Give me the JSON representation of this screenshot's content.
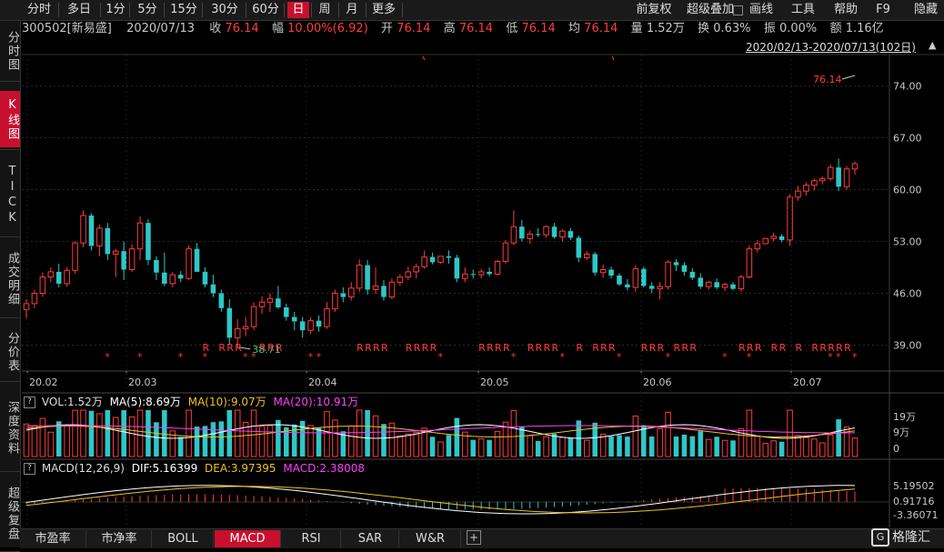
{
  "toolbar": {
    "periods": [
      "分时",
      "多日",
      "1分",
      "5分",
      "15分",
      "30分",
      "60分",
      "日",
      "周",
      "月",
      "更多"
    ],
    "active_period": "日",
    "right": [
      "前复权",
      "超级叠加",
      "画线",
      "工具",
      "帮助",
      "F9",
      "隐藏"
    ]
  },
  "sidebar": {
    "items": [
      "分时图",
      "K线图",
      "TICK",
      "成交明细",
      "分价表",
      "深度资料",
      "超级复盘"
    ],
    "active": "K线图"
  },
  "info": {
    "code": "300502[新易盛]",
    "date": "2020/07/13",
    "close_label": "收",
    "close": "76.14",
    "change_label": "幅",
    "change": "10.00%(6.92)",
    "open_label": "开",
    "open": "76.14",
    "high_label": "高",
    "high": "76.14",
    "low_label": "低",
    "low": "76.14",
    "avg_label": "均",
    "avg": "76.14",
    "volume_label": "量",
    "volume": "1.52万",
    "turnover_label": "换",
    "turnover": "0.63%",
    "amplitude_label": "振",
    "amplitude": "0.00%",
    "amount_label": "额",
    "amount": "1.16亿",
    "range": "2020/02/13-2020/07/13(102日)"
  },
  "volume_panel": {
    "label": "VOL:1.52万",
    "ma5": "MA(5):8.69万",
    "ma10": "MA(10):9.07万",
    "ma20": "MA(20):10.91万",
    "axis": [
      "19万",
      "9万",
      "0"
    ]
  },
  "macd_panel": {
    "label": "MACD(12,26,9)",
    "dif": "DIF:5.16399",
    "dea": "DEA:3.97395",
    "macd": "MACD:2.38008",
    "axis": [
      "5.19502",
      "0.91716",
      "-3.36071"
    ]
  },
  "bottom_tabs": [
    "市盈率",
    "市净率",
    "BOLL",
    "MACD",
    "RSI",
    "SAR",
    "W&R"
  ],
  "bottom_active": "MACD",
  "logo_text": "格隆汇",
  "colors": {
    "up": "#ff3b3b",
    "down": "#2fc7c7",
    "bg": "#000000",
    "accent": "#c8102e",
    "ma5": "#ffffff",
    "ma10": "#f0c020",
    "ma20": "#ff40ff"
  },
  "chart_data": {
    "type": "candlestick",
    "price_axis": [
      "74.00",
      "67.00",
      "60.00",
      "53.00",
      "46.00",
      "39.00"
    ],
    "ylim": [
      35.5,
      78
    ],
    "date_axis": [
      "20.02",
      "20.03",
      "20.04",
      "20.05",
      "20.06",
      "20.07"
    ],
    "max_label": "76.14",
    "min_label": "38.71",
    "candles": [
      [
        43.8,
        45.2,
        42.6,
        44.6
      ],
      [
        44.6,
        46.5,
        44.0,
        46.0
      ],
      [
        46.0,
        48.8,
        45.5,
        48.2
      ],
      [
        48.2,
        49.5,
        47.5,
        48.9
      ],
      [
        48.9,
        50.0,
        46.8,
        47.3
      ],
      [
        47.3,
        49.5,
        46.9,
        49.1
      ],
      [
        49.1,
        53.0,
        48.6,
        52.8
      ],
      [
        52.8,
        57.2,
        52.2,
        56.5
      ],
      [
        56.5,
        56.8,
        51.8,
        52.4
      ],
      [
        52.4,
        55.3,
        51.0,
        54.8
      ],
      [
        54.8,
        55.5,
        50.5,
        51.3
      ],
      [
        51.3,
        52.0,
        48.2,
        51.7
      ],
      [
        51.7,
        53.0,
        47.8,
        49.2
      ],
      [
        49.2,
        52.6,
        48.9,
        52.0
      ],
      [
        52.0,
        56.4,
        50.5,
        55.5
      ],
      [
        55.5,
        56.0,
        49.8,
        50.5
      ],
      [
        50.5,
        51.0,
        47.8,
        48.8
      ],
      [
        48.8,
        51.5,
        47.0,
        47.3
      ],
      [
        47.3,
        48.9,
        46.8,
        48.5
      ],
      [
        48.5,
        49.0,
        47.5,
        48.0
      ],
      [
        48.0,
        52.5,
        47.8,
        52.0
      ],
      [
        52.0,
        52.8,
        50.0,
        48.9
      ],
      [
        48.9,
        49.5,
        46.8,
        47.2
      ],
      [
        47.2,
        48.5,
        45.5,
        46.0
      ],
      [
        46.0,
        46.5,
        43.5,
        44.0
      ],
      [
        44.0,
        45.2,
        39.0,
        40.0
      ],
      [
        40.0,
        42.5,
        38.71,
        41.2
      ],
      [
        41.2,
        42.8,
        40.2,
        41.5
      ],
      [
        41.5,
        44.8,
        41.0,
        44.2
      ],
      [
        44.2,
        45.6,
        43.2,
        44.8
      ],
      [
        44.8,
        46.0,
        43.5,
        45.3
      ],
      [
        45.3,
        47.0,
        43.9,
        44.1
      ],
      [
        44.1,
        44.6,
        42.3,
        42.8
      ],
      [
        42.8,
        43.5,
        41.0,
        42.2
      ],
      [
        42.2,
        42.8,
        40.0,
        41.0
      ],
      [
        41.0,
        42.8,
        40.5,
        42.3
      ],
      [
        42.3,
        43.0,
        40.8,
        41.5
      ],
      [
        41.5,
        44.8,
        41.2,
        43.9
      ],
      [
        43.9,
        46.5,
        43.5,
        46.0
      ],
      [
        46.0,
        46.8,
        44.8,
        45.5
      ],
      [
        45.5,
        47.5,
        45.0,
        46.7
      ],
      [
        46.7,
        50.6,
        46.2,
        49.8
      ],
      [
        49.8,
        50.5,
        45.8,
        46.5
      ],
      [
        46.5,
        49.5,
        45.9,
        47.0
      ],
      [
        47.0,
        47.8,
        45.0,
        45.5
      ],
      [
        45.5,
        48.0,
        45.2,
        47.5
      ],
      [
        47.5,
        48.6,
        47.0,
        48.2
      ],
      [
        48.2,
        49.6,
        47.8,
        48.9
      ],
      [
        48.9,
        50.0,
        48.0,
        49.6
      ],
      [
        49.6,
        51.8,
        49.3,
        50.9
      ],
      [
        50.9,
        51.5,
        49.9,
        50.2
      ],
      [
        50.2,
        51.0,
        50.0,
        51.0
      ],
      [
        51.0,
        51.8,
        50.0,
        50.8
      ],
      [
        50.8,
        51.2,
        47.5,
        48.0
      ],
      [
        48.0,
        49.5,
        47.5,
        48.6
      ],
      [
        48.6,
        49.2,
        48.0,
        48.5
      ],
      [
        48.5,
        49.3,
        48.0,
        48.9
      ],
      [
        48.9,
        49.5,
        48.3,
        48.6
      ],
      [
        48.6,
        50.5,
        48.4,
        50.3
      ],
      [
        50.3,
        53.2,
        50.0,
        52.8
      ],
      [
        52.8,
        57.2,
        52.5,
        55.0
      ],
      [
        55.0,
        55.9,
        53.0,
        53.4
      ],
      [
        53.4,
        54.5,
        52.7,
        54.0
      ],
      [
        54.0,
        54.8,
        53.6,
        53.9
      ],
      [
        53.9,
        55.2,
        53.5,
        55.0
      ],
      [
        55.0,
        55.5,
        53.4,
        53.6
      ],
      [
        53.6,
        54.6,
        53.0,
        54.4
      ],
      [
        54.4,
        54.8,
        53.2,
        53.5
      ],
      [
        53.5,
        53.8,
        50.2,
        50.8
      ],
      [
        50.8,
        51.7,
        50.5,
        51.3
      ],
      [
        51.3,
        51.6,
        48.4,
        48.8
      ],
      [
        48.8,
        49.9,
        48.1,
        49.2
      ],
      [
        49.2,
        49.6,
        48.0,
        48.4
      ],
      [
        48.4,
        48.7,
        47.0,
        47.2
      ],
      [
        47.2,
        47.9,
        46.4,
        46.8
      ],
      [
        46.8,
        49.8,
        46.2,
        49.3
      ],
      [
        49.3,
        49.6,
        46.8,
        47.0
      ],
      [
        47.0,
        47.5,
        46.0,
        46.6
      ],
      [
        46.6,
        47.5,
        45.2,
        46.9
      ],
      [
        46.9,
        50.5,
        46.5,
        50.2
      ],
      [
        50.2,
        50.6,
        49.0,
        49.8
      ],
      [
        49.8,
        50.2,
        48.4,
        48.9
      ],
      [
        48.9,
        49.4,
        47.8,
        48.1
      ],
      [
        48.1,
        48.7,
        46.6,
        46.9
      ],
      [
        46.9,
        47.7,
        46.5,
        47.5
      ],
      [
        47.5,
        48.0,
        46.5,
        46.8
      ],
      [
        46.8,
        47.4,
        46.3,
        47.2
      ],
      [
        47.2,
        47.5,
        46.4,
        46.6
      ],
      [
        46.6,
        48.5,
        46.2,
        48.2
      ],
      [
        48.2,
        52.5,
        48.0,
        52.0
      ],
      [
        52.0,
        53.2,
        51.5,
        52.7
      ],
      [
        52.7,
        53.5,
        52.6,
        53.4
      ],
      [
        53.4,
        54.2,
        53.0,
        53.7
      ],
      [
        53.7,
        54.0,
        52.9,
        53.2
      ],
      [
        53.2,
        59.4,
        52.4,
        59.0
      ],
      [
        59.0,
        60.5,
        58.5,
        59.8
      ],
      [
        59.8,
        61.0,
        59.2,
        60.6
      ],
      [
        60.6,
        61.5,
        59.9,
        61.2
      ],
      [
        61.2,
        61.8,
        60.7,
        61.5
      ],
      [
        61.5,
        63.4,
        61.2,
        63.0
      ],
      [
        63.0,
        64.2,
        59.8,
        60.4
      ],
      [
        60.4,
        63.2,
        60.0,
        62.8
      ],
      [
        62.8,
        63.8,
        62.0,
        63.5
      ]
    ]
  }
}
